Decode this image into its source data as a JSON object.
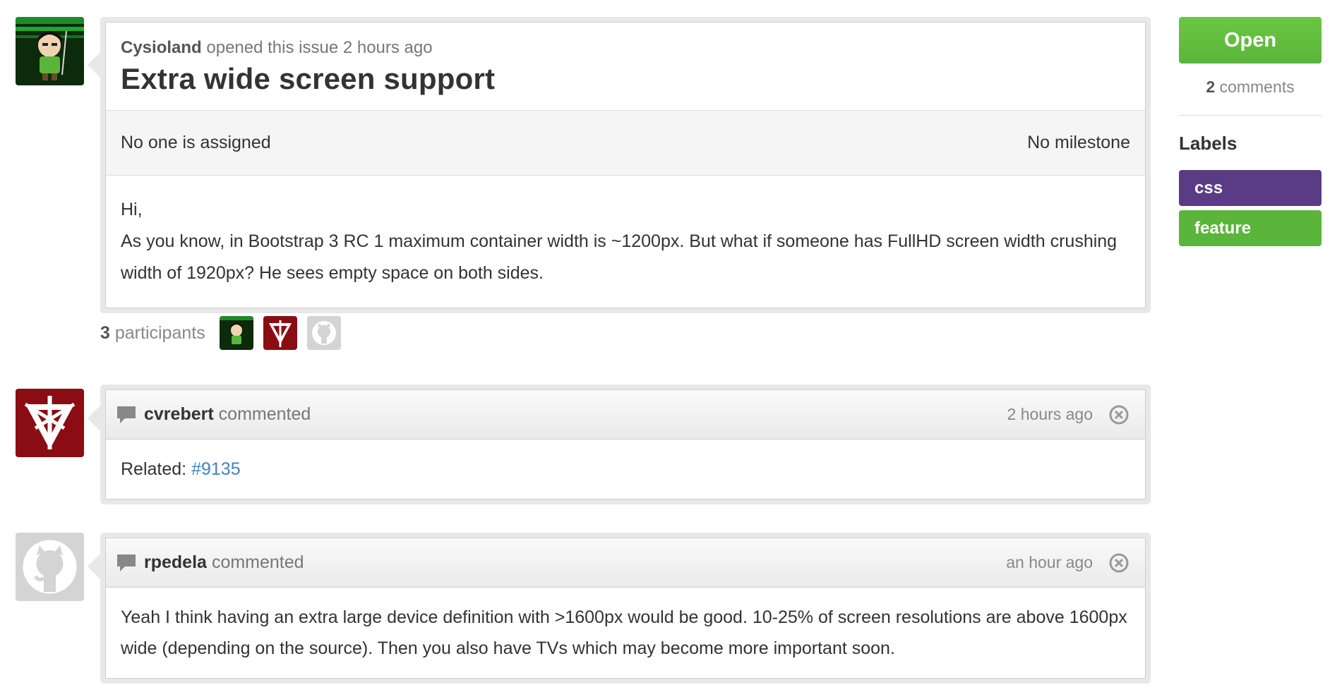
{
  "issue": {
    "author": "Cysioland",
    "opened_text": "opened this issue 2 hours ago",
    "title": "Extra wide screen support",
    "assignee_text": "No one is assigned",
    "milestone_text": "No milestone",
    "body_line1": "Hi,",
    "body_line2": "As you know, in Bootstrap 3 RC 1 maximum container width is ~1200px. But what if someone has FullHD screen width crushing width of 1920px? He sees empty space on both sides."
  },
  "participants": {
    "count": "3",
    "label": "participants"
  },
  "comments": [
    {
      "author": "cvrebert",
      "action": "commented",
      "time": "2 hours ago",
      "body_prefix": "Related:",
      "body_link": "#9135"
    },
    {
      "author": "rpedela",
      "action": "commented",
      "time": "an hour ago",
      "body": "Yeah I think having an extra large device definition with >1600px would be good. 10-25% of screen resolutions are above 1600px wide (depending on the source). Then you also have TVs which may become more important soon."
    }
  ],
  "sidebar": {
    "state_label": "Open",
    "comment_count": "2",
    "comment_count_label": "comments",
    "labels_title": "Labels",
    "labels": [
      {
        "name": "css",
        "color": "#5a3c86"
      },
      {
        "name": "feature",
        "color": "#5bb53a"
      }
    ]
  },
  "colors": {
    "link": "#4183c4",
    "open_green": "#6cc644",
    "css_purple": "#5a3c86",
    "feature_green": "#5bb53a"
  }
}
